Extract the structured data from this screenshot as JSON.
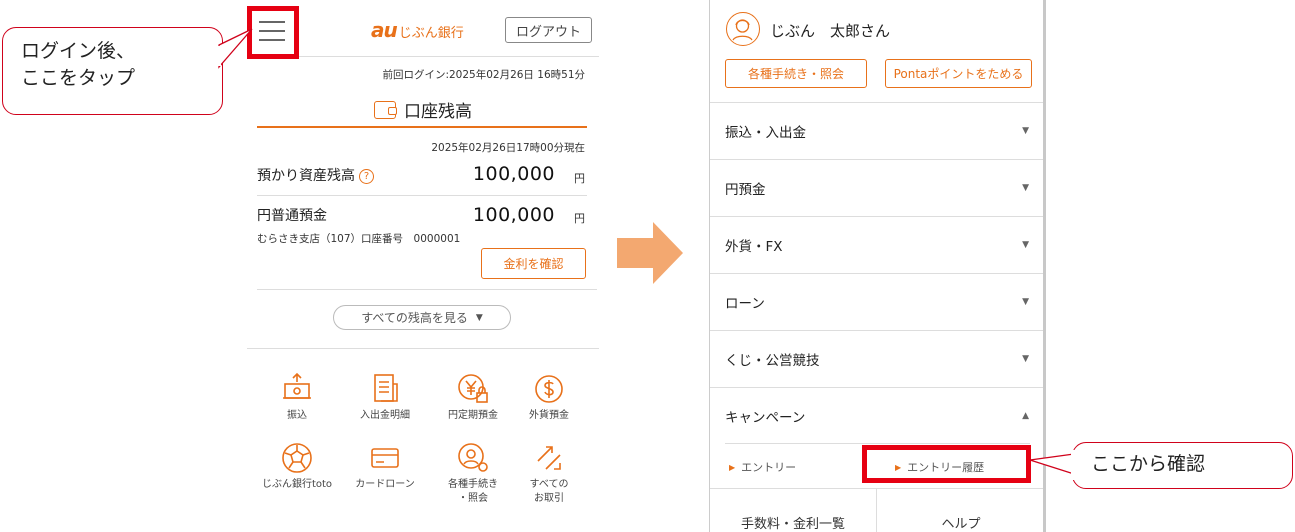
{
  "annotations": {
    "left_callout": [
      "ログイン後、",
      "ここをタップ"
    ],
    "right_callout": "ここから確認"
  },
  "left": {
    "header": {
      "logo_au": "au",
      "logo_bank": "じぶん銀行",
      "logout_label": "ログアウト"
    },
    "last_login": "前回ログイン:2025年02月26日 16時51分",
    "section_title": "口座残高",
    "as_of": "2025年02月26日17時00分現在",
    "total": {
      "label": "預かり資産残高",
      "amount": "100,000",
      "unit": "円",
      "help": "?"
    },
    "savings": {
      "label": "円普通預金",
      "amount": "100,000",
      "unit": "円",
      "branch": "むらさき支店（107）口座番号　0000001"
    },
    "rate_button": "金利を確認",
    "all_balance_button": "すべての残高を見る",
    "menu": [
      {
        "label": "振込"
      },
      {
        "label": "入出金明細"
      },
      {
        "label": "円定期預金"
      },
      {
        "label": "外貨預金"
      },
      {
        "label": "じぶん銀行toto"
      },
      {
        "label": "カードローン"
      },
      {
        "label": "各種手続き\n・照会"
      },
      {
        "label": "すべての\nお取引"
      }
    ]
  },
  "right": {
    "username": "じぶん　太郎さん",
    "buttons": {
      "procedures": "各種手続き・照会",
      "ponta": "Pontaポイントをためる"
    },
    "rows": [
      {
        "label": "振込・入出金",
        "caret": "▼"
      },
      {
        "label": "円預金",
        "caret": "▼"
      },
      {
        "label": "外貨・FX",
        "caret": "▼"
      },
      {
        "label": "ローン",
        "caret": "▼"
      },
      {
        "label": "くじ・公営競技",
        "caret": "▼"
      },
      {
        "label": "キャンペーン",
        "caret": "▲"
      }
    ],
    "sub": {
      "entry": "エントリー",
      "entry_history": "エントリー履歴"
    },
    "bottom": {
      "fees": "手数料・金利一覧",
      "help": "ヘルプ"
    }
  },
  "colors": {
    "accent": "#e8711a",
    "highlight": "#e60012",
    "arrow": "#f3a870"
  }
}
